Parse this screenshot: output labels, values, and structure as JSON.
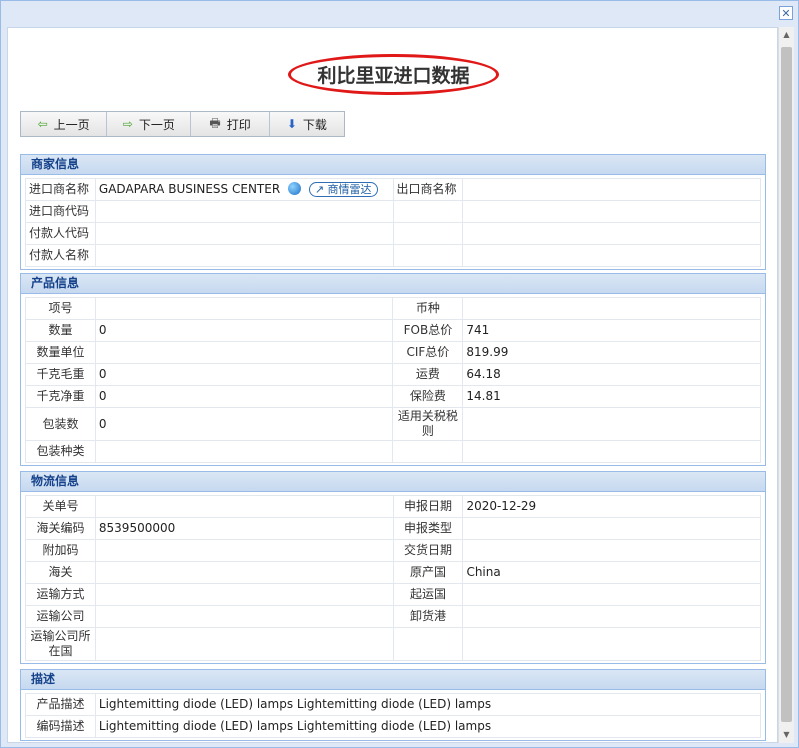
{
  "title": "利比里亚进口数据",
  "toolbar": {
    "prev": "上一页",
    "next": "下一页",
    "print": "打印",
    "download": "下载"
  },
  "icons": {
    "close": "close-icon",
    "prev": "arrow-left-icon",
    "next": "arrow-right-icon",
    "print": "printer-icon",
    "download": "arrow-down-icon",
    "globe": "globe-icon",
    "radar": "radar-icon"
  },
  "colors": {
    "header_text": "#15428b",
    "title_circle": "#e01818",
    "panel_border": "#99bbe8"
  },
  "merchant": {
    "header": "商家信息",
    "importer_name_label": "进口商名称",
    "importer_name": "GADAPARA BUSINESS CENTER",
    "radar_label": "商情雷达",
    "exporter_name_label": "出口商名称",
    "exporter_name": "",
    "importer_code_label": "进口商代码",
    "importer_code": "",
    "payer_code_label": "付款人代码",
    "payer_code": "",
    "payer_name_label": "付款人名称",
    "payer_name": ""
  },
  "product": {
    "header": "产品信息",
    "rows": [
      {
        "l1": "项号",
        "v1": "",
        "l2": "币种",
        "v2": ""
      },
      {
        "l1": "数量",
        "v1": "0",
        "l2": "FOB总价",
        "v2": "741"
      },
      {
        "l1": "数量单位",
        "v1": "",
        "l2": "CIF总价",
        "v2": "819.99"
      },
      {
        "l1": "千克毛重",
        "v1": "0",
        "l2": "运费",
        "v2": "64.18"
      },
      {
        "l1": "千克净重",
        "v1": "0",
        "l2": "保险费",
        "v2": "14.81"
      },
      {
        "l1": "包装数",
        "v1": "0",
        "l2": "适用关税税则",
        "v2": ""
      },
      {
        "l1": "包装种类",
        "v1": "",
        "l2": "",
        "v2": ""
      }
    ]
  },
  "logistics": {
    "header": "物流信息",
    "rows": [
      {
        "l1": "关单号",
        "v1": "",
        "l2": "申报日期",
        "v2": "2020-12-29"
      },
      {
        "l1": "海关编码",
        "v1": "8539500000",
        "l2": "申报类型",
        "v2": ""
      },
      {
        "l1": "附加码",
        "v1": "",
        "l2": "交货日期",
        "v2": ""
      },
      {
        "l1": "海关",
        "v1": "",
        "l2": "原产国",
        "v2": "China"
      },
      {
        "l1": "运输方式",
        "v1": "",
        "l2": "起运国",
        "v2": ""
      },
      {
        "l1": "运输公司",
        "v1": "",
        "l2": "卸货港",
        "v2": ""
      },
      {
        "l1": "运输公司所在国",
        "v1": "",
        "l2": "",
        "v2": ""
      }
    ]
  },
  "description": {
    "header": "描述",
    "product_desc_label": "产品描述",
    "product_desc": "Lightemitting diode (LED) lamps Lightemitting diode (LED) lamps",
    "code_desc_label": "编码描述",
    "code_desc": "Lightemitting diode (LED) lamps Lightemitting diode (LED) lamps"
  }
}
